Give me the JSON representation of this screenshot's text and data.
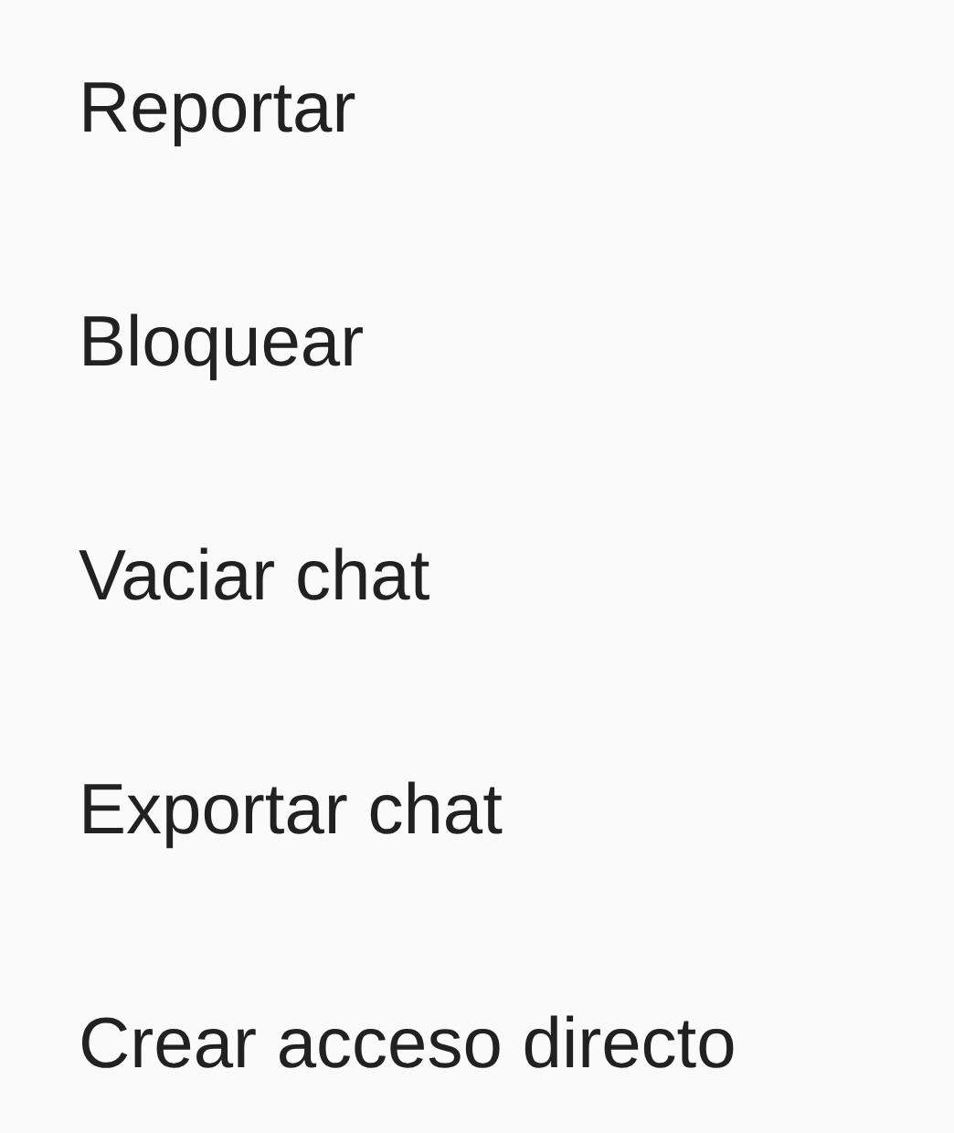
{
  "menu": {
    "items": [
      {
        "label": "Reportar"
      },
      {
        "label": "Bloquear"
      },
      {
        "label": "Vaciar chat"
      },
      {
        "label": "Exportar chat"
      },
      {
        "label": "Crear acceso directo"
      }
    ]
  }
}
